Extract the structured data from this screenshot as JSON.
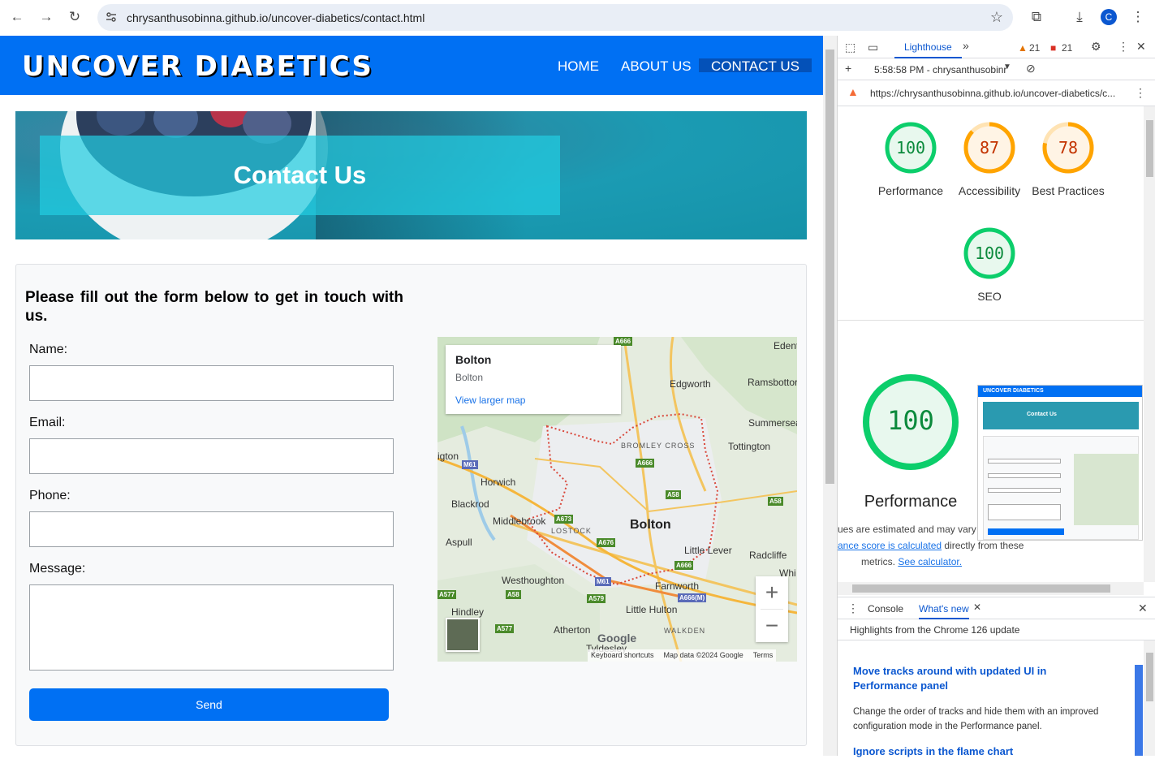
{
  "browser": {
    "url": "chrysanthusobinna.github.io/uncover-diabetics/contact.html",
    "profile_initial": "C"
  },
  "site": {
    "logo": "UNCOVER DIABETICS",
    "nav": [
      "HOME",
      "ABOUT US",
      "CONTACT US"
    ],
    "hero_title": "Contact Us",
    "form_intro": "Please fill out the form below to get in touch with us.",
    "labels": {
      "name": "Name:",
      "email": "Email:",
      "phone": "Phone:",
      "message": "Message:"
    },
    "send_label": "Send",
    "colors": {
      "brand": "#0070f3",
      "hero_overlay": "#22cce0"
    }
  },
  "map": {
    "info_title": "Bolton",
    "info_subtitle": "Bolton",
    "info_link": "View larger map",
    "places": {
      "edenfield": "Edent",
      "edgworth": "Edgworth",
      "ramsbottom": "Ramsbottor",
      "summerseat": "Summersea",
      "bromley_cross": "BROMLEY CROSS",
      "tottington": "Tottington",
      "adlington": "igton",
      "horwich": "Horwich",
      "blackrod": "Blackrod",
      "middlebrook": "Middlebrook",
      "lostock": "LOSTOCK",
      "bolton": "Bolton",
      "aspull": "Aspull",
      "little_lever": "Little Lever",
      "radcliffe": "Radcliffe",
      "westhoughton": "Westhoughton",
      "farnworth": "Farnworth",
      "whitefield": "Whi",
      "hindley": "Hindley",
      "little_hulton": "Little Hulton",
      "atherton": "Atherton",
      "walkden": "WALKDEN",
      "tyldesley": "Tyldesley"
    },
    "roads": [
      "A666",
      "M61",
      "A666",
      "A58",
      "A58",
      "A673",
      "A676",
      "A666",
      "M61",
      "A666(M)",
      "A58",
      "A579",
      "A577",
      "A577"
    ],
    "google_logo": "Google",
    "footer": [
      "Keyboard shortcuts",
      "Map data ©2024 Google",
      "Terms"
    ]
  },
  "devtools": {
    "active_tab": "Lighthouse",
    "warnings": "21",
    "errors": "21",
    "report_time": "5:58:58 PM - chrysanthusobinr",
    "report_url": "https://chrysanthusobinna.github.io/uncover-diabetics/c...",
    "scores": [
      {
        "label": "Performance",
        "value": 100,
        "color": "#0cce6b",
        "text_color": "#0b8a3c"
      },
      {
        "label": "Accessibility",
        "value": 87,
        "color": "#ffa400",
        "text_color": "#c33300"
      },
      {
        "label": "Best Practices",
        "value": 78,
        "color": "#ffa400",
        "text_color": "#c33300"
      },
      {
        "label": "SEO",
        "value": 100,
        "color": "#0cce6b",
        "text_color": "#0b8a3c"
      }
    ],
    "big_score": "100",
    "big_label": "Performance",
    "note_line1": "ues are estimated and may vary",
    "note_link1": "ance score is calculated",
    "note_line2": " directly from these",
    "note_line3": "metrics.",
    "note_link2": "See calculator.",
    "drawer_tabs": [
      "Console",
      "What's new"
    ],
    "drawer_header": "Highlights from the Chrome 126 update",
    "news": [
      {
        "title": "Move tracks around with updated UI in Performance panel",
        "body": "Change the order of tracks and hide them with an improved configuration mode in the Performance panel."
      },
      {
        "title": "Ignore scripts in the flame chart",
        "body": ""
      }
    ]
  }
}
